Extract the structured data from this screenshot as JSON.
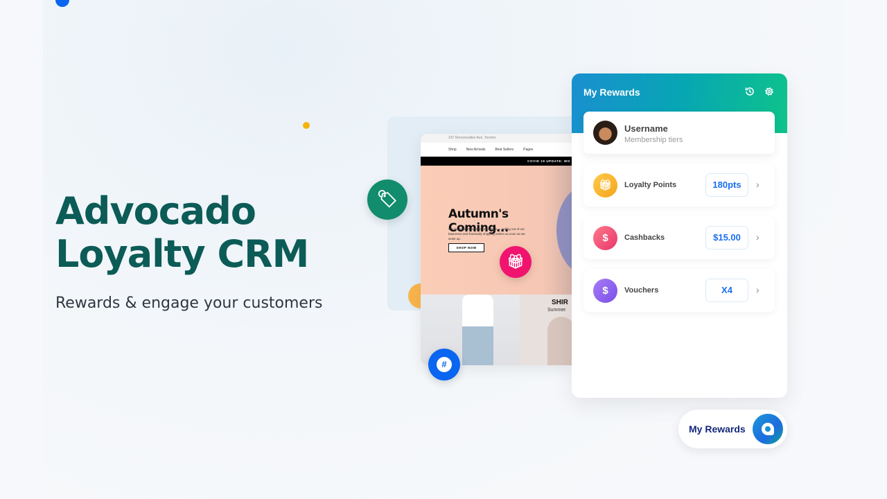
{
  "hero": {
    "title_line1": "Advocado",
    "title_line2": "Loyalty CRM",
    "subtitle": "Rewards & engage your customers"
  },
  "storefront": {
    "address": "237 Roncesvalles Ave, Toronto",
    "nav": [
      "Shop",
      "New Arrivals",
      "Best Sellers",
      "Pages"
    ],
    "banner": "COVID 19 UPDATE: WO",
    "headline": "Autumn's Coming...",
    "body": "We started with humble beginnings — selling out of our basement and frantically shipping orders as soon as we woke up.",
    "button": "SHOP NOW",
    "section_title": "SHIR",
    "section_sub": "Summer"
  },
  "rewards": {
    "title": "My Rewards",
    "username": "Username",
    "tier": "Membership tiers",
    "rows": [
      {
        "label": "Loyalty Points",
        "value": "180pts",
        "icon": "gift-icon",
        "color": "#f8b32b"
      },
      {
        "label": "Cashbacks",
        "value": "$15.00",
        "icon": "cashback-icon",
        "color": "#ef476f"
      },
      {
        "label": "Vouchers",
        "value": "X4",
        "icon": "voucher-icon",
        "color": "#8a5cf0"
      }
    ]
  },
  "launcher": {
    "label": "My Rewards"
  },
  "colors": {
    "brand_teal": "#0c5b57",
    "accent_blue": "#1a6ef0"
  }
}
